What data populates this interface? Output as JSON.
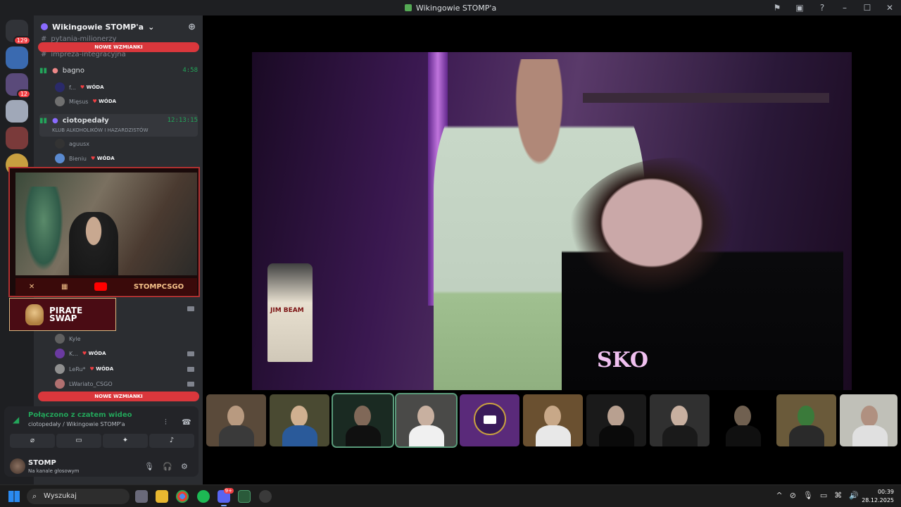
{
  "window": {
    "title": "Wikingowie STOMP'a"
  },
  "titlebar_controls": [
    "flag-icon",
    "inbox-icon",
    "help-icon",
    "minimize-icon",
    "maximize-icon",
    "close-icon"
  ],
  "guilds": {
    "badge_top": "129",
    "badge_second": "12"
  },
  "server": {
    "name": "Wikingowie STOMP'a"
  },
  "banner": {
    "mentions_top": "NOWE WZMIANKI",
    "mentions_bottom": "NOWE WZMIANKI"
  },
  "channels": {
    "ch1": "pytania-milionerzy",
    "ch2": "impreza-integracyjna"
  },
  "voice_channels": [
    {
      "name": "bagno",
      "time": "4:58"
    },
    {
      "name": "ciotopedały",
      "time": "12:13:15",
      "sub": "KLUB ALKOHOLIKÓW I HAZARDZISTÓW"
    }
  ],
  "members": {
    "bagno": [
      {
        "name": "f...",
        "tag": "WÓDA"
      },
      {
        "name": "Mięsus",
        "tag": "WÓDA"
      }
    ],
    "ciotopedaly": [
      {
        "name": "aguusx"
      },
      {
        "name": "Bieniu",
        "tag": "WÓDA"
      }
    ],
    "lower": [
      {
        "name": "Kyle"
      },
      {
        "name": "K...",
        "tag": "WÓDA"
      },
      {
        "name": "LeRu*",
        "tag": "WÓDA"
      },
      {
        "name": "LWariato_CSGO"
      }
    ]
  },
  "overlay": {
    "handle": "STOMPCSGO",
    "sponsor_line1": "PIRATE",
    "sponsor_line2": "SWAP"
  },
  "voice_panel": {
    "status": "Połączono z czatem wideo",
    "channel": "ciotopedały / Wikingowie STOMP'a",
    "user": "STOMP",
    "user_status": "Na kanale głosowym"
  },
  "video": {
    "shirt_text": "SKO",
    "bottle_label": "JIM BEAM"
  },
  "taskbar": {
    "search_placeholder": "Wyszukaj",
    "discord_badge": "9+",
    "time": "00:39",
    "date": "28.12.2025"
  }
}
